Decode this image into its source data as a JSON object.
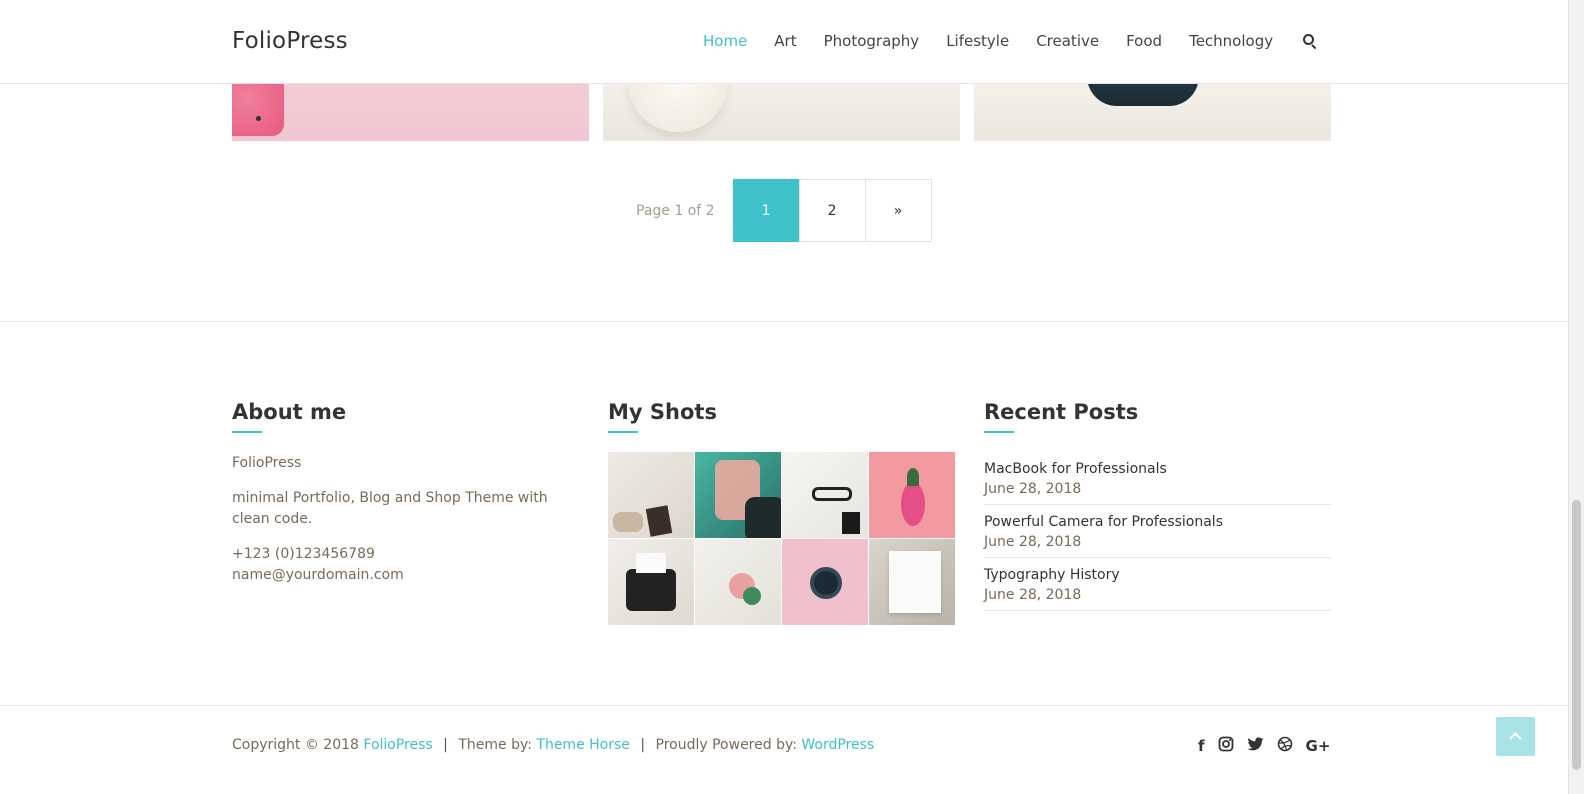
{
  "header": {
    "brand": "FolioPress",
    "nav": [
      "Home",
      "Art",
      "Photography",
      "Lifestyle",
      "Creative",
      "Food",
      "Technology"
    ],
    "active_nav": "Home"
  },
  "pagination": {
    "info": "Page 1 of 2",
    "pages": [
      "1",
      "2"
    ],
    "current": "1",
    "next": "»"
  },
  "about": {
    "title": "About me",
    "name": "FolioPress",
    "description": "minimal Portfolio, Blog and Shop Theme with clean code.",
    "phone": "+123 (0)123456789",
    "email": "name@yourdomain.com"
  },
  "shots": {
    "title": "My Shots"
  },
  "recent": {
    "title": "Recent Posts",
    "items": [
      {
        "title": "MacBook for Professionals",
        "date": "June 28, 2018"
      },
      {
        "title": "Powerful Camera for Professionals",
        "date": "June 28, 2018"
      },
      {
        "title": "Typography History",
        "date": "June 28, 2018"
      }
    ]
  },
  "footer": {
    "copyright_prefix": "Copyright © 2018",
    "brand_link": "FolioPress",
    "sep": "|",
    "theme_by": "Theme by:",
    "theme_link": "Theme Horse",
    "powered_by": "Proudly Powered by:",
    "powered_link": "WordPress",
    "social": {
      "facebook": "f",
      "googleplus": "G+"
    }
  },
  "colors": {
    "accent": "#3fc1c9",
    "back_to_top": "#a7e3e6",
    "muted_text": "#7a6a58"
  },
  "icons": [
    "search-icon",
    "facebook-icon",
    "instagram-icon",
    "twitter-icon",
    "dribbble-icon",
    "google-plus-icon",
    "chevron-up-icon"
  ]
}
